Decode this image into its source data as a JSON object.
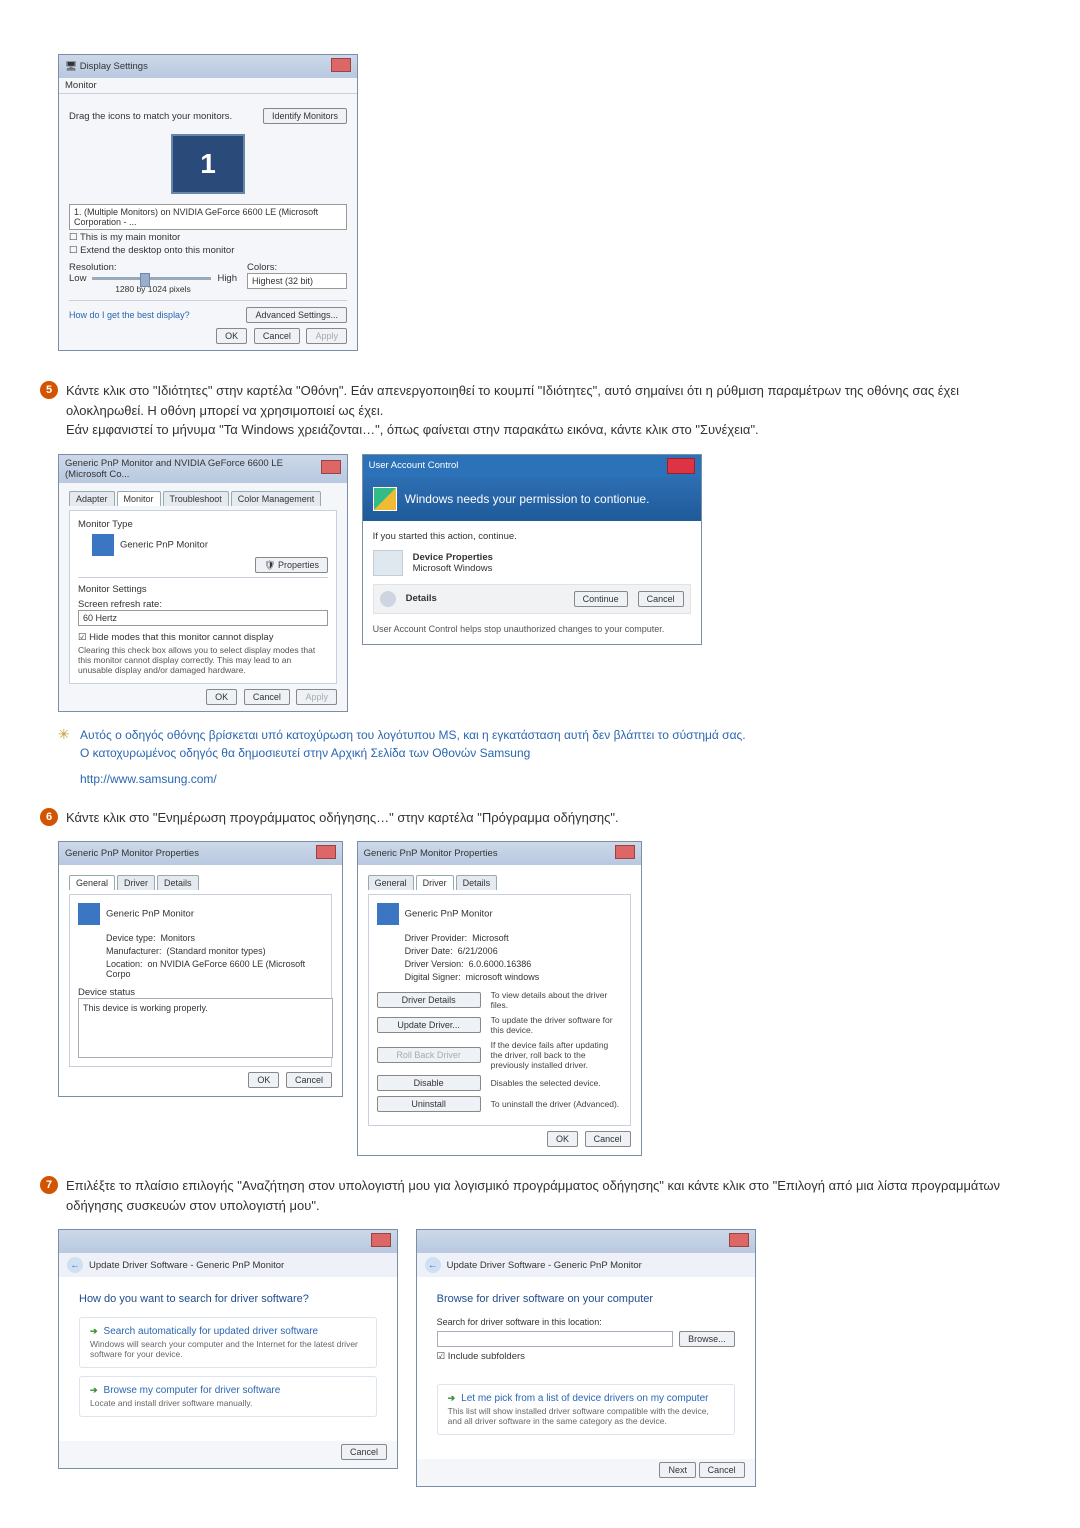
{
  "display_dialog": {
    "title": "Display Settings",
    "menu": "Monitor",
    "drag_text": "Drag the icons to match your monitors.",
    "identify_btn": "Identify Monitors",
    "monitor_number": "1",
    "adapter_dropdown": "1. (Multiple Monitors) on NVIDIA GeForce 6600 LE (Microsoft Corporation - ...",
    "chk_main": "This is my main monitor",
    "chk_extend": "Extend the desktop onto this monitor",
    "res_label": "Resolution:",
    "res_low": "Low",
    "res_high": "High",
    "res_value": "1280 by 1024 pixels",
    "colors_label": "Colors:",
    "colors_value": "Highest (32 bit)",
    "help_link": "How do I get the best display?",
    "adv_btn": "Advanced Settings...",
    "ok": "OK",
    "cancel": "Cancel",
    "apply": "Apply"
  },
  "step5": {
    "num": "5",
    "line1": "Κάντε κλικ στο \"Ιδιότητες\" στην καρτέλα \"Οθόνη\". Εάν απενεργοποιηθεί το κουμπί \"Ιδιότητες\", αυτό σημαίνει ότι η ρύθμιση παραμέτρων της οθόνης σας έχει ολοκληρωθεί. Η οθόνη μπορεί να χρησιμοποιεί ως έχει.",
    "line2": "Εάν εμφανιστεί το μήνυμα \"Τα Windows χρειάζονται…\", όπως φαίνεται στην παρακάτω εικόνα, κάντε κλικ στο \"Συνέχεια\"."
  },
  "monitor_tab": {
    "title": "Generic PnP Monitor and NVIDIA GeForce 6600 LE (Microsoft Co...",
    "tab_adapter": "Adapter",
    "tab_monitor": "Monitor",
    "tab_trouble": "Troubleshoot",
    "tab_color": "Color Management",
    "type_label": "Monitor Type",
    "type_value": "Generic PnP Monitor",
    "props_btn": "Properties",
    "settings_label": "Monitor Settings",
    "refresh_label": "Screen refresh rate:",
    "refresh_value": "60 Hertz",
    "hide_chk": "Hide modes that this monitor cannot display",
    "hide_desc": "Clearing this check box allows you to select display modes that this monitor cannot display correctly. This may lead to an unusable display and/or damaged hardware.",
    "ok": "OK",
    "cancel": "Cancel",
    "apply": "Apply"
  },
  "uac": {
    "title": "User Account Control",
    "banner": "Windows needs your permission to contionue.",
    "started": "If you started this action, continue.",
    "prog_name": "Device Properties",
    "prog_pub": "Microsoft Windows",
    "details": "Details",
    "continue": "Continue",
    "cancel": "Cancel",
    "help": "User Account Control helps stop unauthorized changes to your computer."
  },
  "note": {
    "line1": "Αυτός ο οδηγός οθόνης βρίσκεται υπό κατοχύρωση του λογότυπου MS, και η εγκατάσταση αυτή δεν βλάπτει το σύστημά σας.",
    "line2": "Ο κατοχυρωμένος οδηγός θα δημοσιευτεί στην Αρχική Σελίδα των Οθονών Samsung",
    "link": "http://www.samsung.com/"
  },
  "step6": {
    "num": "6",
    "text": "Κάντε κλικ στο \"Ενημέρωση προγράμματος οδήγησης…\" στην καρτέλα \"Πρόγραμμα οδήγησης\"."
  },
  "props_general": {
    "title": "Generic PnP Monitor Properties",
    "tab_general": "General",
    "tab_driver": "Driver",
    "tab_details": "Details",
    "name": "Generic PnP Monitor",
    "dev_type_l": "Device type:",
    "dev_type_v": "Monitors",
    "manu_l": "Manufacturer:",
    "manu_v": "(Standard monitor types)",
    "loc_l": "Location:",
    "loc_v": "on NVIDIA GeForce 6600 LE (Microsoft Corpo",
    "status_label": "Device status",
    "status_txt": "This device is working properly.",
    "ok": "OK",
    "cancel": "Cancel"
  },
  "props_driver": {
    "title": "Generic PnP Monitor Properties",
    "name": "Generic PnP Monitor",
    "provider_l": "Driver Provider:",
    "provider_v": "Microsoft",
    "date_l": "Driver Date:",
    "date_v": "6/21/2006",
    "ver_l": "Driver Version:",
    "ver_v": "6.0.6000.16386",
    "signer_l": "Digital Signer:",
    "signer_v": "microsoft windows",
    "b1": "Driver Details",
    "b1d": "To view details about the driver files.",
    "b2": "Update Driver...",
    "b2d": "To update the driver software for this device.",
    "b3": "Roll Back Driver",
    "b3d": "If the device fails after updating the driver, roll back to the previously installed driver.",
    "b4": "Disable",
    "b4d": "Disables the selected device.",
    "b5": "Uninstall",
    "b5d": "To uninstall the driver (Advanced).",
    "ok": "OK",
    "cancel": "Cancel"
  },
  "step7": {
    "num": "7",
    "text": "Επιλέξτε το πλαίσιο επιλογής \"Αναζήτηση στον υπολογιστή μου για λογισμικό προγράμματος οδήγησης\" και κάντε κλικ στο \"Επιλογή από μια λίστα προγραμμάτων οδήγησης συσκευών στον υπολογιστή μου\"."
  },
  "wiz1": {
    "header": "Update Driver Software - Generic PnP Monitor",
    "q": "How do you want to search for driver software?",
    "opt1_t": "Search automatically for updated driver software",
    "opt1_d": "Windows will search your computer and the Internet for the latest driver software for your device.",
    "opt2_t": "Browse my computer for driver software",
    "opt2_d": "Locate and install driver software manually.",
    "cancel": "Cancel"
  },
  "wiz2": {
    "header": "Update Driver Software - Generic PnP Monitor",
    "q": "Browse for driver software on your computer",
    "loc_label": "Search for driver software in this location:",
    "browse": "Browse...",
    "include": "Include subfolders",
    "opt_t": "Let me pick from a list of device drivers on my computer",
    "opt_d": "This list will show installed driver software compatible with the device, and all driver software in the same category as the device.",
    "next": "Next",
    "cancel": "Cancel"
  }
}
